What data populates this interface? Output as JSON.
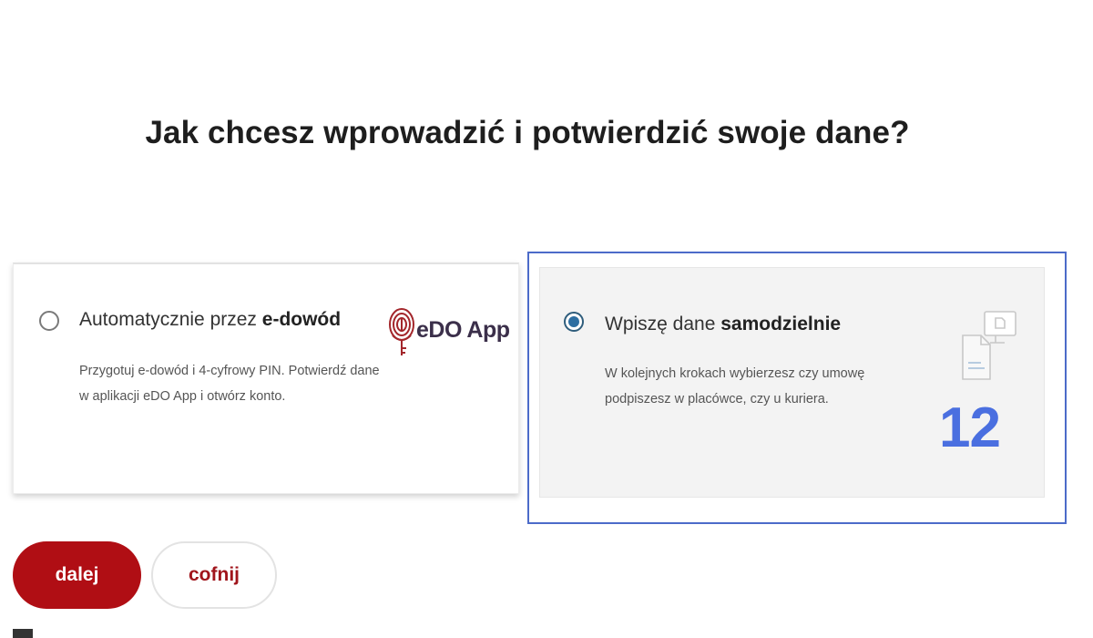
{
  "page": {
    "title": "Jak chcesz wprowadzić i potwierdzić swoje dane?"
  },
  "options": [
    {
      "heading_prefix": "Automatycznie przez ",
      "heading_bold": "e-dowód",
      "description": "Przygotuj e-dowód i 4-cyfrowy PIN. Potwierdź dane w aplikacji eDO App i otwórz konto.",
      "logo_text": "eDO App",
      "selected": false
    },
    {
      "heading_prefix": "Wpiszę dane ",
      "heading_bold": "samodzielnie",
      "description": "W kolejnych krokach wybierzesz czy umowę podpiszesz w placówce, czy u kuriera.",
      "icon": "document-monitor-icon",
      "selected": true
    }
  ],
  "annotation": {
    "step_number": "12",
    "color": "#4a6fe0"
  },
  "buttons": {
    "next_label": "dalej",
    "back_label": "cofnij"
  },
  "colors": {
    "primary_red": "#b00e14",
    "selection_blue": "#4c6bc9",
    "radio_selected": "#2d6ea1"
  }
}
